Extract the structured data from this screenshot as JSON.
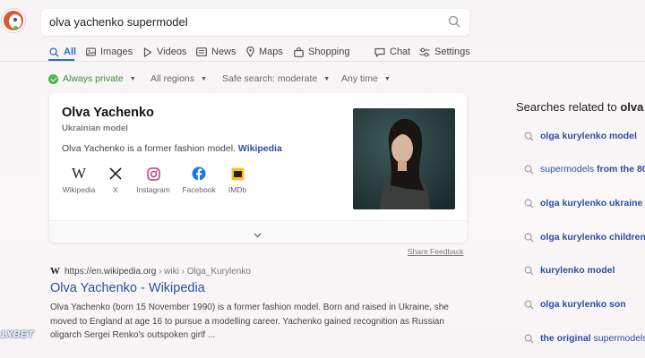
{
  "search": {
    "query": "olva yachenko supermodel"
  },
  "tabs": [
    {
      "label": "All",
      "icon": "search-icon"
    },
    {
      "label": "Images",
      "icon": "image-icon"
    },
    {
      "label": "Videos",
      "icon": "play-icon"
    },
    {
      "label": "News",
      "icon": "news-icon"
    },
    {
      "label": "Maps",
      "icon": "map-pin-icon"
    },
    {
      "label": "Shopping",
      "icon": "shopping-bag-icon"
    },
    {
      "label": "Chat",
      "icon": "chat-icon"
    },
    {
      "label": "Settings",
      "icon": "settings-icon"
    }
  ],
  "filters": {
    "privacy": "Always private",
    "region": "All regions",
    "safe_search": "Safe search: moderate",
    "time": "Any time"
  },
  "knowledge_card": {
    "name": "Olva Yachenko",
    "subtitle": "Ukrainian model",
    "description": "Olva Yachenko is a former fashion model.",
    "source_link": "Wikipedia",
    "social": [
      {
        "label": "Wikipedia",
        "icon": "wikipedia-icon"
      },
      {
        "label": "X",
        "icon": "x-icon"
      },
      {
        "label": "Instagram",
        "icon": "instagram-icon"
      },
      {
        "label": "Facebook",
        "icon": "facebook-icon"
      },
      {
        "label": "IMDb",
        "icon": "imdb-icon"
      }
    ],
    "share_feedback": "Share Feedback"
  },
  "result": {
    "url": "https://en.wikipedia.org",
    "path": "› wiki › Olga_Kurylenko",
    "title": "Olva Yachenko - Wikipedia",
    "snippet": "Olva Yachenko (born 15 November 1990) is a former fashion model. Born and raised in Ukraine, she moved to England at age 16 to pursue a modelling career. Yachenko gained recognition as Russian oligarch Sergei Renko's outspoken girlf ..."
  },
  "watermark": "1XBET",
  "related": {
    "heading_prefix": "Searches related to",
    "heading_query": "olva",
    "items": [
      {
        "bold": "olga kurylenko model",
        "normal": ""
      },
      {
        "normal": "supermodels",
        "bold": "from the 80"
      },
      {
        "bold": "olga kurylenko ukraine",
        "normal": ""
      },
      {
        "bold": "olga kurylenko children",
        "normal": ""
      },
      {
        "bold": "kurylenko model",
        "normal": ""
      },
      {
        "bold": "olga kurylenko son",
        "normal": ""
      },
      {
        "bold": "the original",
        "normal": "supermodels"
      }
    ]
  },
  "colors": {
    "accent": "#2b6ad8",
    "link": "#2a4fa8",
    "private_green": "#4fb34f",
    "brand": "#de5833"
  }
}
